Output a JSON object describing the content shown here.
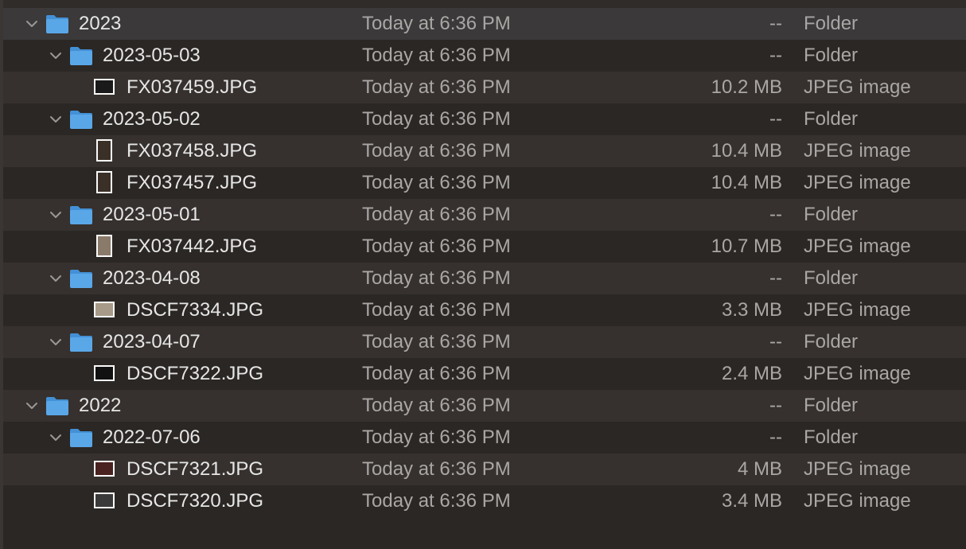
{
  "rows": [
    {
      "level": 0,
      "type": "folder",
      "name": "2023",
      "date": "Today at 6:36 PM",
      "size": "--",
      "kind": "Folder",
      "expanded": true
    },
    {
      "level": 1,
      "type": "folder",
      "name": "2023-05-03",
      "date": "Today at 6:36 PM",
      "size": "--",
      "kind": "Folder",
      "expanded": true
    },
    {
      "level": 2,
      "type": "image",
      "orient": "wide",
      "tone": "#1a1a1a",
      "name": "FX037459.JPG",
      "date": "Today at 6:36 PM",
      "size": "10.2 MB",
      "kind": "JPEG image"
    },
    {
      "level": 1,
      "type": "folder",
      "name": "2023-05-02",
      "date": "Today at 6:36 PM",
      "size": "--",
      "kind": "Folder",
      "expanded": true
    },
    {
      "level": 2,
      "type": "image",
      "orient": "tall",
      "tone": "#3a3028",
      "name": "FX037458.JPG",
      "date": "Today at 6:36 PM",
      "size": "10.4 MB",
      "kind": "JPEG image"
    },
    {
      "level": 2,
      "type": "image",
      "orient": "tall",
      "tone": "#3a3028",
      "name": "FX037457.JPG",
      "date": "Today at 6:36 PM",
      "size": "10.4 MB",
      "kind": "JPEG image"
    },
    {
      "level": 1,
      "type": "folder",
      "name": "2023-05-01",
      "date": "Today at 6:36 PM",
      "size": "--",
      "kind": "Folder",
      "expanded": true
    },
    {
      "level": 2,
      "type": "image",
      "orient": "tall",
      "tone": "#8a7a6a",
      "name": "FX037442.JPG",
      "date": "Today at 6:36 PM",
      "size": "10.7 MB",
      "kind": "JPEG image"
    },
    {
      "level": 1,
      "type": "folder",
      "name": "2023-04-08",
      "date": "Today at 6:36 PM",
      "size": "--",
      "kind": "Folder",
      "expanded": true
    },
    {
      "level": 2,
      "type": "image",
      "orient": "wide",
      "tone": "#a79a88",
      "name": "DSCF7334.JPG",
      "date": "Today at 6:36 PM",
      "size": "3.3 MB",
      "kind": "JPEG image"
    },
    {
      "level": 1,
      "type": "folder",
      "name": "2023-04-07",
      "date": "Today at 6:36 PM",
      "size": "--",
      "kind": "Folder",
      "expanded": true
    },
    {
      "level": 2,
      "type": "image",
      "orient": "wide",
      "tone": "#111111",
      "name": "DSCF7322.JPG",
      "date": "Today at 6:36 PM",
      "size": "2.4 MB",
      "kind": "JPEG image"
    },
    {
      "level": 0,
      "type": "folder",
      "name": "2022",
      "date": "Today at 6:36 PM",
      "size": "--",
      "kind": "Folder",
      "expanded": true
    },
    {
      "level": 1,
      "type": "folder",
      "name": "2022-07-06",
      "date": "Today at 6:36 PM",
      "size": "--",
      "kind": "Folder",
      "expanded": true
    },
    {
      "level": 2,
      "type": "image",
      "orient": "wide",
      "tone": "#4a2220",
      "name": "DSCF7321.JPG",
      "date": "Today at 6:36 PM",
      "size": "4 MB",
      "kind": "JPEG image"
    },
    {
      "level": 2,
      "type": "image",
      "orient": "wide",
      "tone": "#3a3a3a",
      "name": "DSCF7320.JPG",
      "date": "Today at 6:36 PM",
      "size": "3.4 MB",
      "kind": "JPEG image"
    }
  ],
  "colors": {
    "folder_blue": "#5aa7e8",
    "folder_blue_dark": "#4390d6",
    "selected_row": "#3b3939",
    "stripe_row": "#36312e",
    "base_row": "#2b2724"
  },
  "icons": {
    "folder": "folder-icon",
    "disclosure": "chevron-down-icon",
    "image": "image-thumbnail-icon"
  }
}
